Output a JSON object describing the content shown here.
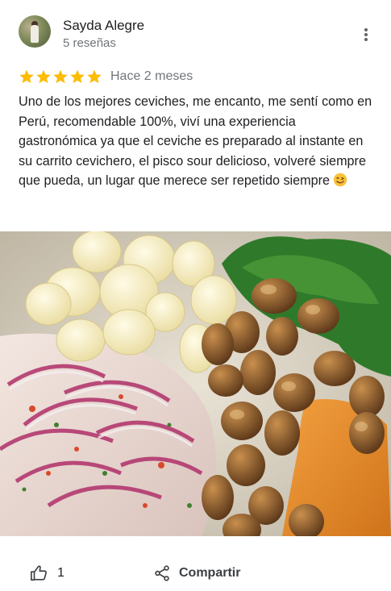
{
  "review": {
    "author_name": "Sayda Alegre",
    "author_meta": "5 reseñas",
    "rating": 5,
    "time": "Hace 2 meses",
    "text": "Uno de los mejores ceviches, me encanto, me sentí como en Perú, recomendable 100%, viví una experiencia gastronómica ya que el ceviche es preparado al instante en su carrito cevichero, el pisco sour delicioso, volveré siempre que pueda, un lugar que merece ser repetido siempre",
    "emoji_icon": "face-savoring-food-icon"
  },
  "actions": {
    "like_count": "1",
    "share_label": "Compartir"
  },
  "colors": {
    "star": "#fbbc04",
    "muted_text": "#70757a",
    "text": "#202124"
  },
  "photo": {
    "subject": "ceviche-photo"
  }
}
